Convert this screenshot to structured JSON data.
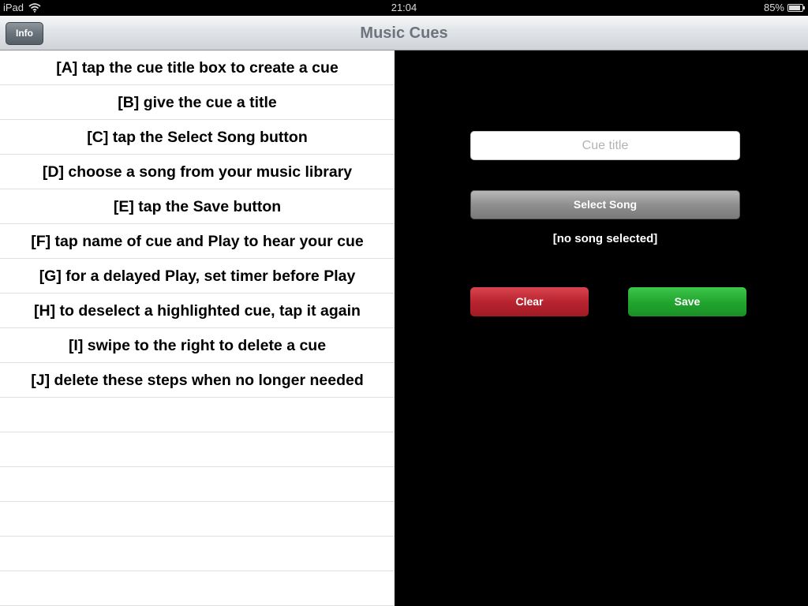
{
  "status_bar": {
    "device": "iPad",
    "time": "21:04",
    "battery": "85%",
    "battery_level": 0.85,
    "wifi_icon": "wifi-icon",
    "battery_icon": "battery-icon"
  },
  "nav": {
    "title": "Music Cues",
    "info_label": "Info"
  },
  "steps": [
    "[A] tap the cue title box to create a cue",
    "[B] give the cue a title",
    "[C] tap the Select Song button",
    "[D] choose a song from your music library",
    "[E] tap the Save button",
    "[F] tap name of cue and Play to hear your cue",
    "[G] for a delayed Play, set timer before Play",
    "[H] to deselect a highlighted cue, tap it again",
    "[I] swipe to the right to delete a cue",
    "[J] delete these steps when no longer needed"
  ],
  "editor": {
    "cue_title_value": "",
    "cue_title_placeholder": "Cue title",
    "select_song_label": "Select Song",
    "song_status": "[no song selected]",
    "clear_label": "Clear",
    "save_label": "Save"
  },
  "colors": {
    "clear": "#b8252f",
    "save": "#22a630",
    "panel_bg": "#000000"
  }
}
